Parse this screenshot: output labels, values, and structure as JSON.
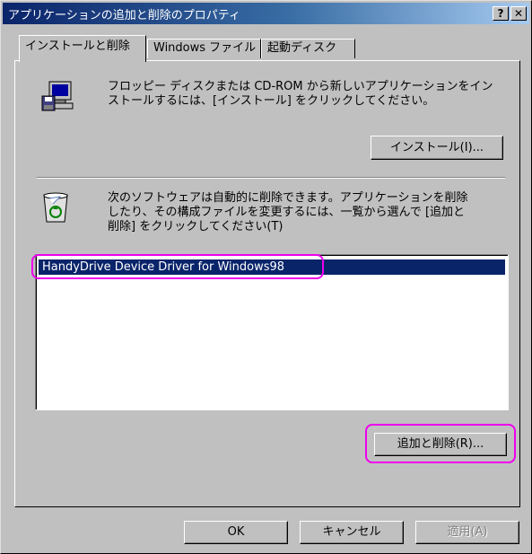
{
  "window": {
    "title": "アプリケーションの追加と削除のプロパティ",
    "help_glyph": "?",
    "close_glyph": "✕"
  },
  "tabs": [
    {
      "label": "インストールと削除",
      "active": true
    },
    {
      "label": "Windows ファイル",
      "active": false
    },
    {
      "label": "起動ディスク",
      "active": false
    }
  ],
  "install_section": {
    "icon": "floppy-computer-icon",
    "description_line1": "フロッピー ディスクまたは CD-ROM から新しいアプリケーションをイン",
    "description_line2": "ストールするには、[インストール] をクリックしてください。",
    "install_button": "インストール(I)..."
  },
  "remove_section": {
    "icon": "recycle-bin-icon",
    "description_line1": "次のソフトウェアは自動的に削除できます。アプリケーションを削除",
    "description_line2": "したり、その構成ファイルを変更するには、一覧から選んで [追加と",
    "description_line3": "削除] をクリックしてください(T)",
    "list_items": [
      "HandyDrive Device Driver for Windows98"
    ],
    "add_remove_button": "追加と削除(R)..."
  },
  "buttons": {
    "ok": "OK",
    "cancel": "キャンセル",
    "apply": "適用(A)"
  },
  "colors": {
    "highlight": "#ee00ee",
    "selection": "#0a246a"
  }
}
